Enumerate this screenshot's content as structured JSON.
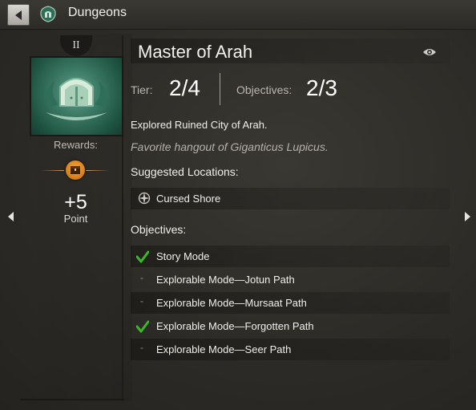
{
  "window": {
    "title": "Dungeons"
  },
  "achievement": {
    "tier_badge": "II",
    "title": "Master of Arah",
    "tier_label": "Tier:",
    "tier_value": "2/4",
    "objectives_label": "Objectives:",
    "objectives_value": "2/3",
    "description": "Explored Ruined City of Arah.",
    "flavor": "Favorite hangout of Giganticus Lupicus."
  },
  "rewards": {
    "label": "Rewards:",
    "points": "+5",
    "unit": "Point"
  },
  "locations": {
    "heading": "Suggested Locations:",
    "items": [
      "Cursed Shore"
    ]
  },
  "objectives": {
    "heading": "Objectives:",
    "items": [
      {
        "label": "Story Mode",
        "done": true
      },
      {
        "label": "Explorable Mode—Jotun Path",
        "done": false
      },
      {
        "label": "Explorable Mode—Mursaat Path",
        "done": false
      },
      {
        "label": "Explorable Mode—Forgotten Path",
        "done": true
      },
      {
        "label": "Explorable Mode—Seer Path",
        "done": false
      }
    ]
  },
  "icons": {
    "back": "back-arrow-icon",
    "emblem": "dungeon-emblem-icon",
    "eye": "eye-icon",
    "compass": "compass-icon",
    "check": "checkmark-icon",
    "chest": "reward-chest-icon"
  },
  "colors": {
    "check": "#3fb52b",
    "reward_gold": "#e58a1e",
    "achievement_green": "#3d7c66"
  }
}
